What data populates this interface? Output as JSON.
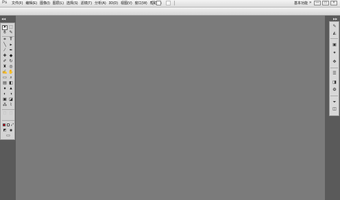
{
  "app": {
    "logo": "Ps"
  },
  "menubar": {
    "items": [
      "文件(F)",
      "编辑(E)",
      "图像(I)",
      "图层(L)",
      "选择(S)",
      "滤镜(T)",
      "分析(A)",
      "3D(D)",
      "视图(V)",
      "窗口(W)",
      "帮助(H)"
    ],
    "workspace_label": "基本功能",
    "workspace_arrow": "»"
  },
  "window_controls": {
    "minimize": "—",
    "restore": "□",
    "close": "×"
  },
  "toolbox": {
    "tools": [
      "move-tool",
      "rect-marquee-tool",
      "lasso-tool",
      "quick-select-tool",
      "crop-tool",
      "slice-tool",
      "eyedropper-tool",
      "ruler-tool",
      "healing-brush-tool",
      "brush-tool",
      "clone-stamp-tool",
      "history-brush-tool",
      "eraser-tool",
      "gradient-tool",
      "blur-tool",
      "dodge-tool",
      "pen-tool",
      "type-tool",
      "path-select-tool",
      "shape-tool",
      "3d-rotate-tool",
      "3d-camera-tool",
      "hand-tool",
      "zoom-tool"
    ],
    "colors": {
      "foreground": "#e0001b",
      "background": "#ffffff"
    }
  },
  "dock": {
    "icons": [
      "color-panel-icon",
      "swatches-panel-icon",
      "styles-panel-icon",
      "adjustments-panel-icon",
      "masks-panel-icon",
      "layers-panel-icon",
      "channels-panel-icon",
      "paths-panel-icon",
      "history-panel-icon",
      "actions-panel-icon"
    ]
  }
}
